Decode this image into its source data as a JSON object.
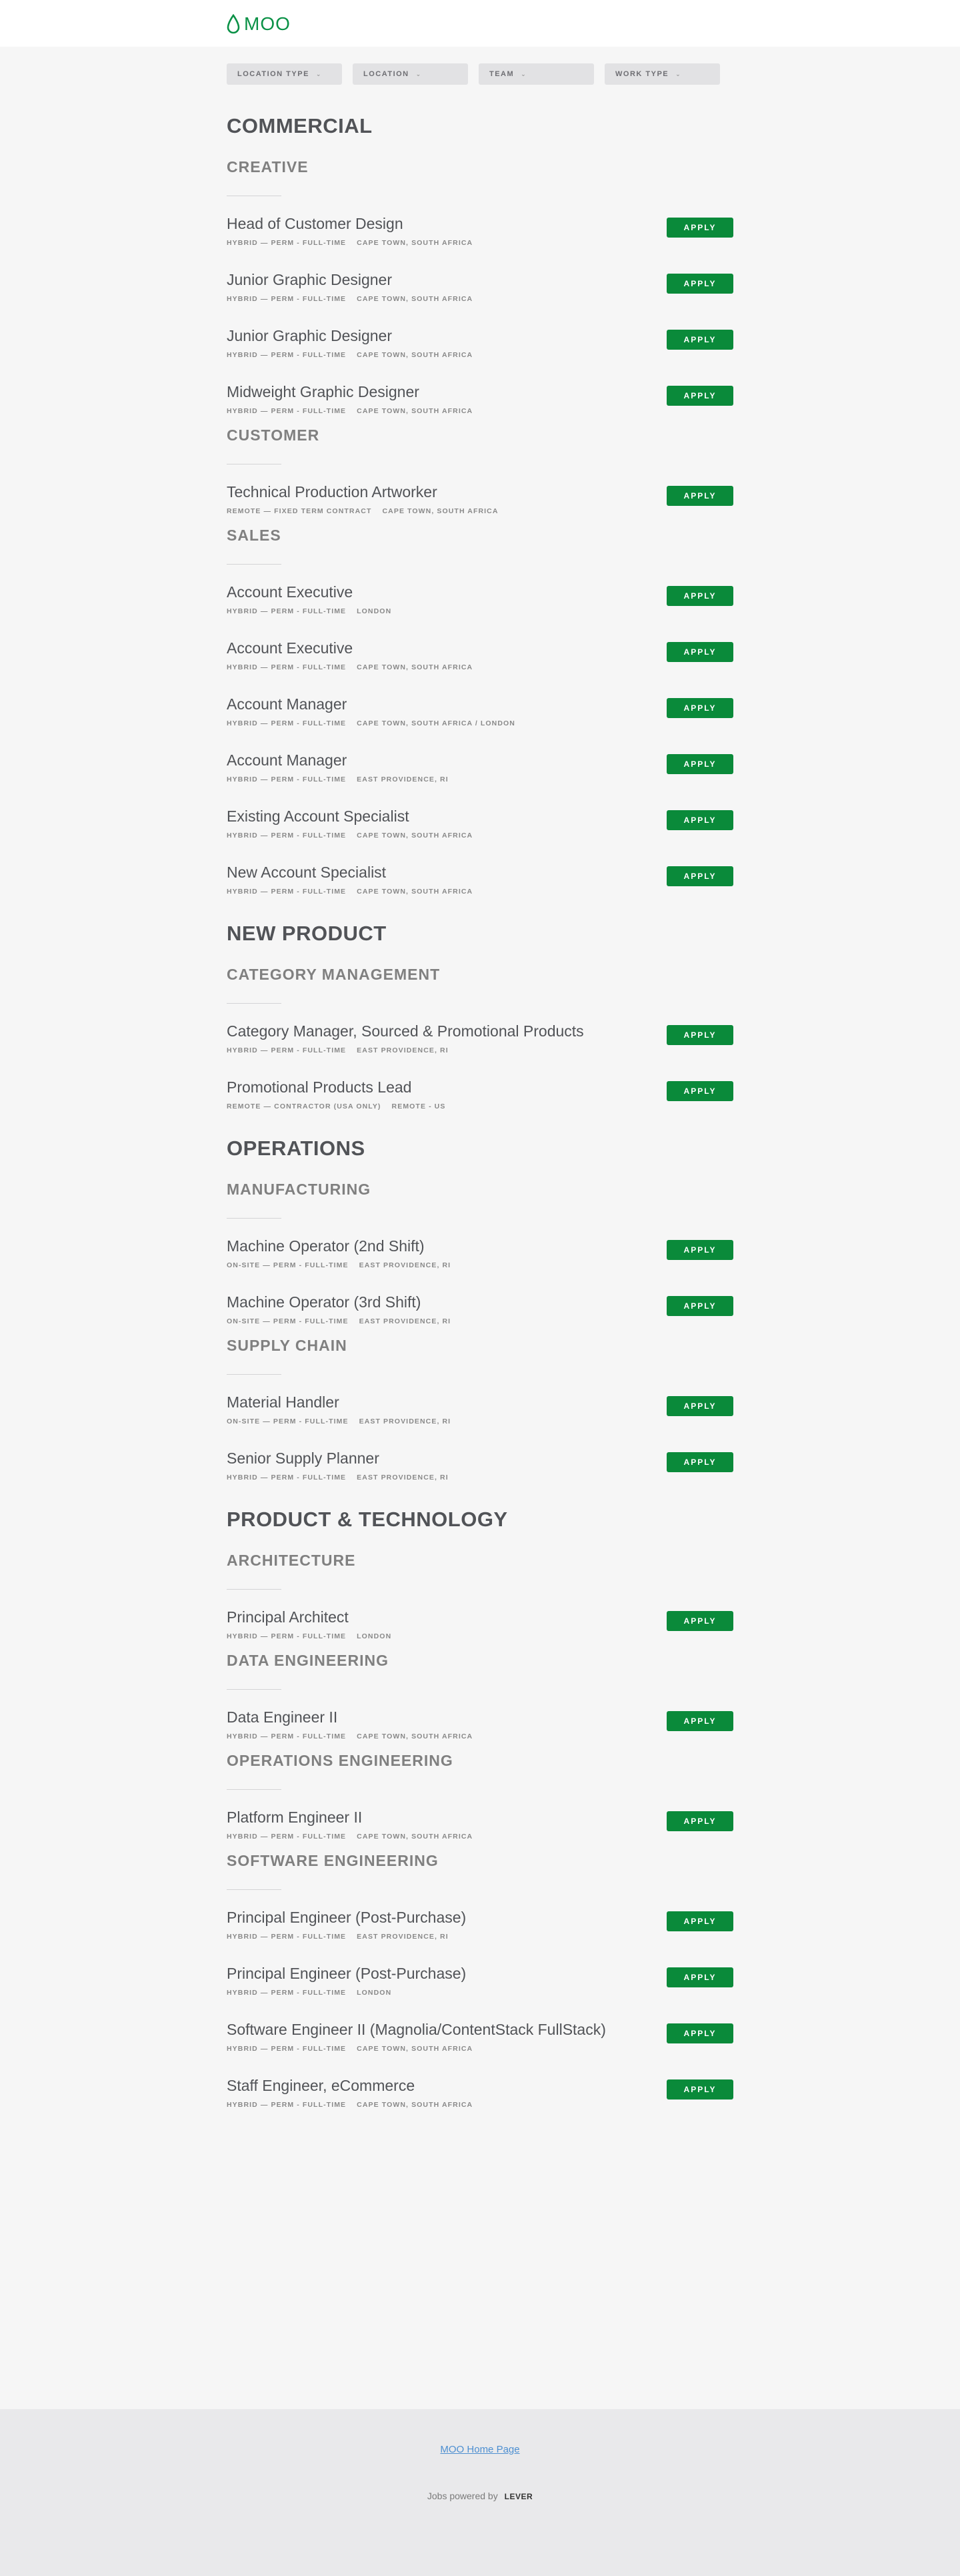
{
  "brand": {
    "name": "MOO",
    "accent": "#0a9146",
    "apply_color": "#0a8a3a"
  },
  "filters": [
    {
      "label": "LOCATION TYPE"
    },
    {
      "label": "LOCATION"
    },
    {
      "label": "TEAM"
    },
    {
      "label": "WORK TYPE"
    }
  ],
  "apply_label": "APPLY",
  "groups": [
    {
      "name": "COMMERCIAL",
      "teams": [
        {
          "name": "CREATIVE",
          "postings": [
            {
              "title": "Head of Customer Design",
              "meta": "HYBRID — PERM - FULL-TIME",
              "location": "CAPE TOWN, SOUTH AFRICA"
            },
            {
              "title": "Junior Graphic Designer",
              "meta": "HYBRID — PERM - FULL-TIME",
              "location": "CAPE TOWN, SOUTH AFRICA"
            },
            {
              "title": "Junior Graphic Designer",
              "meta": "HYBRID — PERM - FULL-TIME",
              "location": "CAPE TOWN, SOUTH AFRICA"
            },
            {
              "title": "Midweight Graphic Designer",
              "meta": "HYBRID — PERM - FULL-TIME",
              "location": "CAPE TOWN, SOUTH AFRICA"
            }
          ]
        },
        {
          "name": "CUSTOMER",
          "postings": [
            {
              "title": "Technical Production Artworker",
              "meta": "REMOTE — FIXED TERM CONTRACT",
              "location": "CAPE TOWN, SOUTH AFRICA"
            }
          ]
        },
        {
          "name": "SALES",
          "postings": [
            {
              "title": "Account Executive",
              "meta": "HYBRID — PERM - FULL-TIME",
              "location": "LONDON"
            },
            {
              "title": "Account Executive",
              "meta": "HYBRID — PERM - FULL-TIME",
              "location": "CAPE TOWN, SOUTH AFRICA"
            },
            {
              "title": "Account Manager",
              "meta": "HYBRID — PERM - FULL-TIME",
              "location": "CAPE TOWN, SOUTH AFRICA / LONDON"
            },
            {
              "title": "Account Manager",
              "meta": "HYBRID — PERM - FULL-TIME",
              "location": "EAST PROVIDENCE, RI"
            },
            {
              "title": "Existing Account Specialist",
              "meta": "HYBRID — PERM - FULL-TIME",
              "location": "CAPE TOWN, SOUTH AFRICA"
            },
            {
              "title": "New Account Specialist",
              "meta": "HYBRID — PERM - FULL-TIME",
              "location": "CAPE TOWN, SOUTH AFRICA"
            }
          ]
        }
      ]
    },
    {
      "name": "NEW PRODUCT",
      "teams": [
        {
          "name": "CATEGORY MANAGEMENT",
          "postings": [
            {
              "title": "Category Manager, Sourced & Promotional Products",
              "meta": "HYBRID — PERM - FULL-TIME",
              "location": "EAST PROVIDENCE, RI"
            },
            {
              "title": "Promotional Products Lead",
              "meta": "REMOTE — CONTRACTOR (USA ONLY)",
              "location": "REMOTE - US"
            }
          ]
        }
      ]
    },
    {
      "name": "OPERATIONS",
      "teams": [
        {
          "name": "MANUFACTURING",
          "postings": [
            {
              "title": "Machine Operator (2nd Shift)",
              "meta": "ON-SITE — PERM - FULL-TIME",
              "location": "EAST PROVIDENCE, RI"
            },
            {
              "title": "Machine Operator (3rd Shift)",
              "meta": "ON-SITE — PERM - FULL-TIME",
              "location": "EAST PROVIDENCE, RI"
            }
          ]
        },
        {
          "name": "SUPPLY CHAIN",
          "postings": [
            {
              "title": "Material Handler",
              "meta": "ON-SITE — PERM - FULL-TIME",
              "location": "EAST PROVIDENCE, RI"
            },
            {
              "title": "Senior Supply Planner",
              "meta": "HYBRID — PERM - FULL-TIME",
              "location": "EAST PROVIDENCE, RI"
            }
          ]
        }
      ]
    },
    {
      "name": "PRODUCT & TECHNOLOGY",
      "teams": [
        {
          "name": "ARCHITECTURE",
          "postings": [
            {
              "title": "Principal Architect",
              "meta": "HYBRID — PERM - FULL-TIME",
              "location": "LONDON"
            }
          ]
        },
        {
          "name": "DATA ENGINEERING",
          "postings": [
            {
              "title": "Data Engineer II",
              "meta": "HYBRID — PERM - FULL-TIME",
              "location": "CAPE TOWN, SOUTH AFRICA"
            }
          ]
        },
        {
          "name": "OPERATIONS ENGINEERING",
          "postings": [
            {
              "title": "Platform Engineer II",
              "meta": "HYBRID — PERM - FULL-TIME",
              "location": "CAPE TOWN, SOUTH AFRICA"
            }
          ]
        },
        {
          "name": "SOFTWARE ENGINEERING",
          "postings": [
            {
              "title": "Principal Engineer (Post-Purchase)",
              "meta": "HYBRID — PERM - FULL-TIME",
              "location": "EAST PROVIDENCE, RI"
            },
            {
              "title": "Principal Engineer (Post-Purchase)",
              "meta": "HYBRID — PERM - FULL-TIME",
              "location": "LONDON"
            },
            {
              "title": "Software Engineer II (Magnolia/ContentStack FullStack)",
              "meta": "HYBRID — PERM - FULL-TIME",
              "location": "CAPE TOWN, SOUTH AFRICA"
            },
            {
              "title": "Staff Engineer, eCommerce",
              "meta": "HYBRID — PERM - FULL-TIME",
              "location": "CAPE TOWN, SOUTH AFRICA"
            }
          ]
        }
      ]
    }
  ],
  "footer": {
    "home_link": "MOO Home Page",
    "powered_by": "Jobs powered by",
    "powered_brand": "LEVER"
  }
}
